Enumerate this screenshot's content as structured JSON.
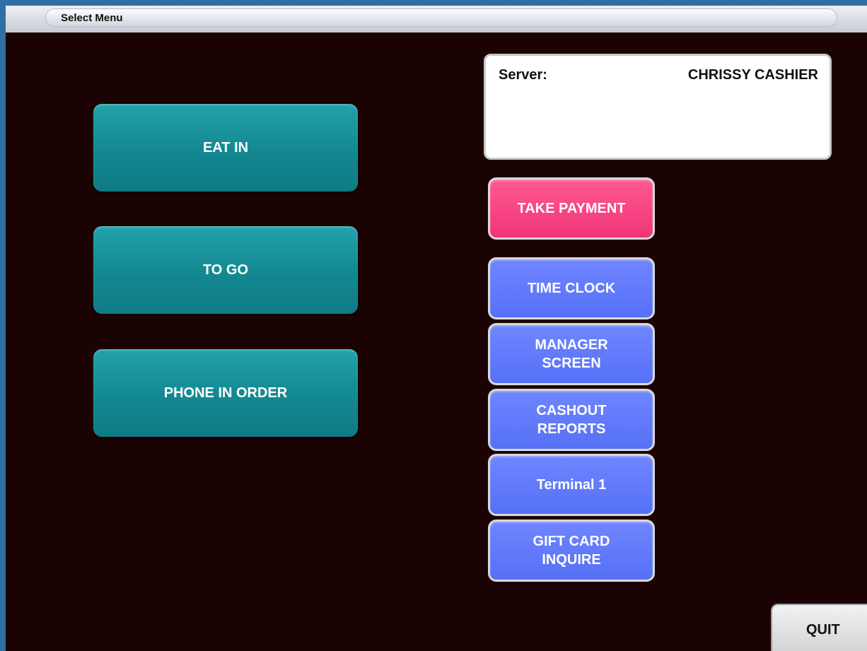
{
  "window": {
    "title": "Select Menu"
  },
  "order_types": {
    "eat_in": "EAT IN",
    "to_go": "TO GO",
    "phone_in_order": "PHONE IN ORDER"
  },
  "server_panel": {
    "label": "Server:",
    "name": "CHRISSY CASHIER"
  },
  "actions": {
    "take_payment": "TAKE  PAYMENT",
    "time_clock": "TIME  CLOCK",
    "manager_screen": "MANAGER\nSCREEN",
    "cashout_reports": "CASHOUT\nREPORTS",
    "terminal": "Terminal 1",
    "gift_card_inquire": "GIFT CARD\nINQUIRE",
    "quit": "QUIT"
  },
  "colors": {
    "background": "#1c0303",
    "order_button": "#138891",
    "payment_button": "#f03478",
    "action_button": "#5670f6",
    "quit_button": "#d9d9d9"
  }
}
